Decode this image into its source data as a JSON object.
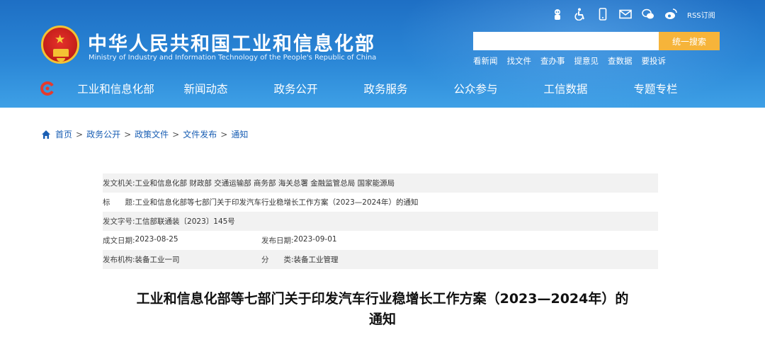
{
  "header": {
    "title_cn": "中华人民共和国工业和信息化部",
    "title_en": "Ministry of Industry and Information Technology of the People's Republic of China",
    "rss_label": "RSS订阅",
    "search": {
      "placeholder": "",
      "button_label": "统一搜索"
    },
    "quick_links": [
      "看新闻",
      "找文件",
      "查办事",
      "提意见",
      "查数据",
      "要投诉"
    ],
    "tool_icons": [
      "robot-icon",
      "accessibility-icon",
      "mobile-icon",
      "mail-icon",
      "wechat-icon",
      "weibo-icon"
    ]
  },
  "nav": {
    "items": [
      "工业和信息化部",
      "新闻动态",
      "政务公开",
      "政务服务",
      "公众参与",
      "工信数据",
      "专题专栏"
    ]
  },
  "breadcrumb": {
    "items": [
      "首页",
      "政务公开",
      "政策文件",
      "文件发布",
      "通知"
    ],
    "separator": ">"
  },
  "meta": {
    "issuer_label": "发文机关:",
    "issuer_value": "工业和信息化部 财政部 交通运输部 商务部 海关总署 金融监管总局 国家能源局",
    "title_label": "标　　题:",
    "title_value": "工业和信息化部等七部门关于印发汽车行业稳增长工作方案（2023—2024年）的通知",
    "docno_label": "发文字号:",
    "docno_value": "工信部联通装〔2023〕145号",
    "created_label": "成文日期:",
    "created_value": "2023-08-25",
    "published_label": "发布日期:",
    "published_value": "2023-09-01",
    "org_label": "发布机构:",
    "org_value": "装备工业一司",
    "category_label": "分　　类:",
    "category_value": "装备工业管理"
  },
  "document": {
    "title_line1": "工业和信息化部等七部门关于印发汽车行业稳增长工作方案（2023—2024年）的",
    "title_line2": "通知"
  },
  "colors": {
    "header_blue": "#2a86d6",
    "search_button": "#f6b43a",
    "breadcrumb_link": "#1a5fb4",
    "meta_shade": "#f2f2f2"
  }
}
